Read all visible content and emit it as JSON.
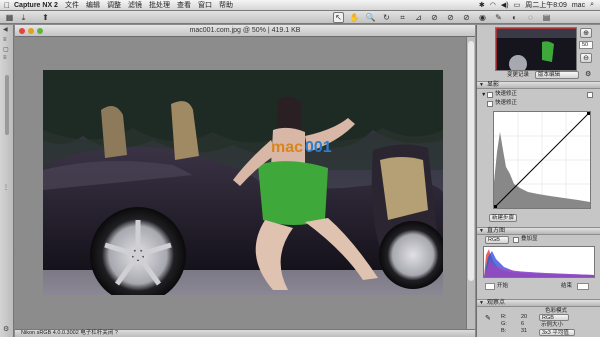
{
  "menubar": {
    "apple": "",
    "app_name": "Capture NX 2",
    "items": [
      "文件",
      "编辑",
      "调整",
      "滤镜",
      "批处理",
      "查看",
      "窗口",
      "帮助"
    ],
    "clock": "周二上午8:09",
    "user": "mac"
  },
  "toolbar": {
    "tools": [
      {
        "name": "select-arrow-tool-icon",
        "glyph": "↖",
        "active": true
      },
      {
        "name": "hand-tool-icon",
        "glyph": "✋",
        "active": false
      },
      {
        "name": "zoom-tool-icon",
        "glyph": "🔍",
        "active": false
      },
      {
        "name": "rotate-tool-icon",
        "glyph": "↻",
        "active": false
      },
      {
        "name": "crop-tool-icon",
        "glyph": "⌗",
        "active": false
      },
      {
        "name": "straighten-tool-icon",
        "glyph": "⊿",
        "active": false
      },
      {
        "name": "black-point-icon",
        "glyph": "⊘",
        "active": false
      },
      {
        "name": "white-point-icon",
        "glyph": "⊘",
        "active": false
      },
      {
        "name": "neutral-point-icon",
        "glyph": "⊘",
        "active": false
      },
      {
        "name": "red-eye-icon",
        "glyph": "◉",
        "active": false
      },
      {
        "name": "auto-retouch-icon",
        "glyph": "✎",
        "active": false
      },
      {
        "name": "selection-brush-icon",
        "glyph": "◐",
        "active": false
      },
      {
        "name": "lasso-icon",
        "glyph": "◌",
        "active": false
      },
      {
        "name": "gradient-icon",
        "glyph": "▤",
        "active": false
      }
    ]
  },
  "document": {
    "title": "mac001.com.jpg @ 50% | 419.1 KB",
    "watermark_top": "mac",
    "watermark_bottom": "001",
    "status": "Nikon sRGB 4.0.0.3002  电子杠杆关闭  ?"
  },
  "panel": {
    "zoom_value": "50",
    "edit_list_label": "变更记录",
    "edit_list_value": "版本编辑",
    "section_develop": "显影",
    "item_quick_fix": "快速修正",
    "item_quick_fix_2": "快速修正",
    "new_step_button": "新建步骤",
    "section_histogram": "直方图",
    "channel_select": "RGB",
    "overlay_label": "叠加显",
    "input_label": "开始",
    "output_label": "结束",
    "section_info": "观察点",
    "color_mode_label": "色彩模式",
    "info_r_label": "R:",
    "info_r_value": "20",
    "info_g_label": "G:",
    "info_g_value": "6",
    "info_b_label": "B:",
    "info_b_value": "31",
    "info_right_1": "RGB",
    "info_right_2": "示例大小",
    "info_right_3": "3x3 平均值"
  },
  "colors": {
    "accent": "#3b6fd6",
    "dress": "#3fa83a"
  }
}
